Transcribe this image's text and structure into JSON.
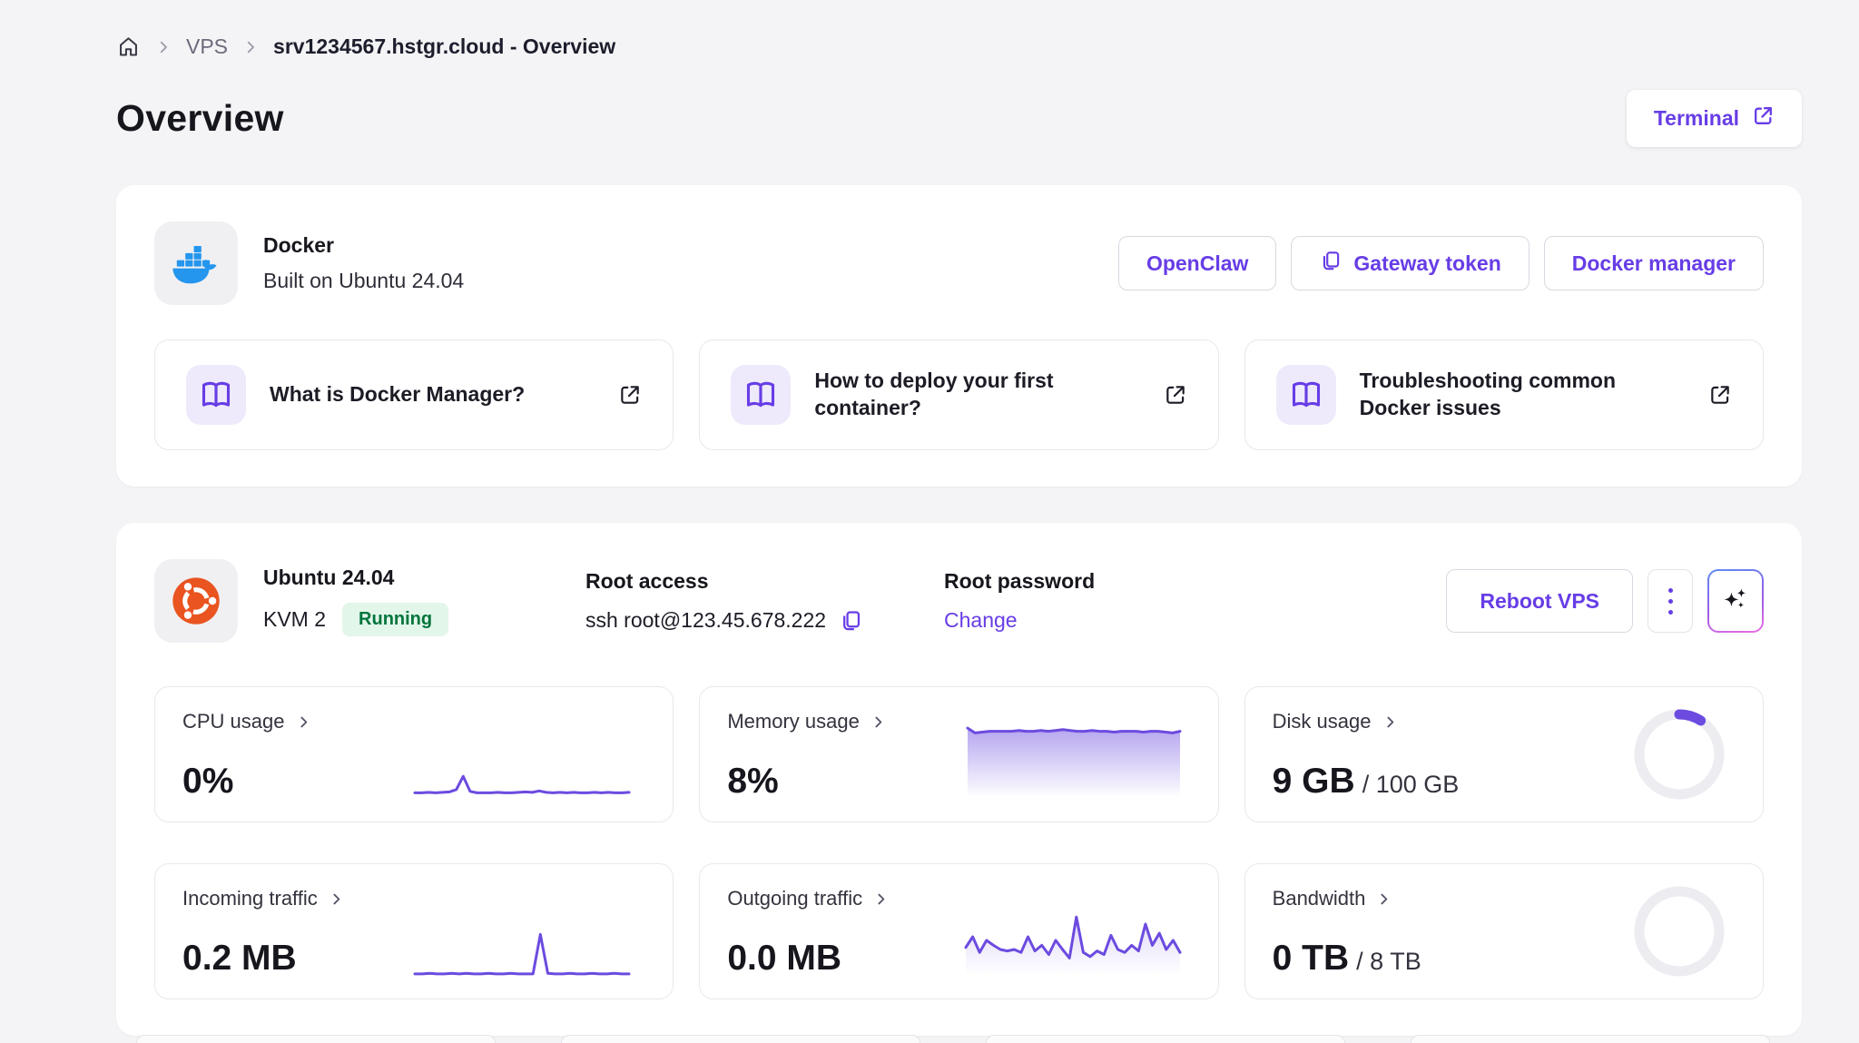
{
  "colors": {
    "accent": "#673de6",
    "chart_purple": "#6c4be0",
    "page_bg": "#f4f4f6",
    "running_bg": "#e3f6ea",
    "running_text": "#00753c",
    "docker_blue": "#2496ed",
    "ubuntu_orange": "#e95420",
    "donut_track": "#ececf1"
  },
  "breadcrumb": {
    "section": "VPS",
    "current": "srv1234567.hstgr.cloud - Overview"
  },
  "page": {
    "title": "Overview",
    "terminal_button": "Terminal"
  },
  "docker_card": {
    "title": "Docker",
    "subtitle": "Built on Ubuntu 24.04",
    "actions": {
      "openclaw": "OpenClaw",
      "gateway_token": "Gateway token",
      "docker_manager": "Docker manager"
    },
    "help_links": [
      {
        "label": "What is Docker Manager?"
      },
      {
        "label": "How to deploy your first container?"
      },
      {
        "label": "Troubleshooting common Docker issues"
      }
    ]
  },
  "server_card": {
    "os": "Ubuntu 24.04",
    "plan": "KVM 2",
    "status": "Running",
    "root_access": {
      "label": "Root access",
      "value": "ssh root@123.45.678.222"
    },
    "root_password": {
      "label": "Root password",
      "action": "Change"
    },
    "reboot_button": "Reboot VPS",
    "metrics": [
      {
        "id": "cpu",
        "label": "CPU usage",
        "value": "0%",
        "chart": "line",
        "points": [
          5,
          5,
          6,
          5,
          6,
          7,
          12,
          40,
          8,
          5,
          5,
          5,
          6,
          5,
          5,
          6,
          7,
          6,
          9,
          6,
          5,
          6,
          5,
          6,
          5,
          5,
          6,
          5,
          6,
          5,
          5,
          6
        ]
      },
      {
        "id": "memory",
        "label": "Memory usage",
        "value": "8%",
        "chart": "line",
        "fill": 0.5,
        "points": [
          84,
          78,
          79,
          80,
          80,
          80,
          80,
          81,
          80,
          80,
          81,
          80,
          81,
          82,
          81,
          80,
          80,
          81,
          80,
          80,
          79,
          80,
          80,
          80,
          79,
          80,
          80,
          79,
          78,
          80
        ]
      },
      {
        "id": "disk",
        "label": "Disk usage",
        "value": "9 GB",
        "suffix": "/ 100 GB",
        "chart": "donut",
        "percent": 9,
        "max": "100 GB"
      },
      {
        "id": "incoming",
        "label": "Incoming traffic",
        "value": "0.2 MB",
        "chart": "line",
        "points": [
          6,
          6,
          7,
          6,
          6,
          7,
          6,
          7,
          6,
          6,
          7,
          6,
          6,
          7,
          6,
          6,
          6,
          70,
          7,
          6,
          6,
          7,
          6,
          6,
          7,
          6,
          6,
          7,
          6,
          6
        ]
      },
      {
        "id": "outgoing",
        "label": "Outgoing traffic",
        "value": "0.0 MB",
        "chart": "line",
        "fill": 0.22,
        "points": [
          35,
          50,
          28,
          45,
          38,
          32,
          30,
          32,
          28,
          50,
          30,
          38,
          25,
          45,
          32,
          20,
          78,
          28,
          22,
          30,
          25,
          52,
          32,
          28,
          38,
          30,
          68,
          38,
          55,
          32,
          45,
          28
        ]
      },
      {
        "id": "bandwidth",
        "label": "Bandwidth",
        "value": "0 TB",
        "suffix": "/ 8 TB",
        "chart": "donut",
        "percent": 0,
        "max": "8 TB"
      }
    ]
  }
}
